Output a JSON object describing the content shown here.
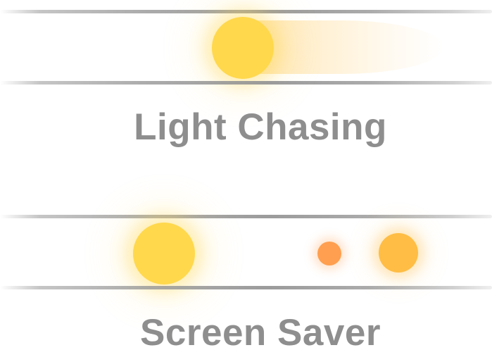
{
  "effects": [
    {
      "title": "Light Chasing",
      "colors": {
        "orb": "#FFD84C",
        "trail": "#FFCE60",
        "rail": "#969696"
      }
    },
    {
      "title": "Screen Saver",
      "colors": {
        "large_orb": "#FFD84C",
        "small_orb": "#FF9F4F",
        "medium_orb": "#FFBD45",
        "rail": "#969696"
      }
    }
  ],
  "colors": {
    "title_text": "#8E8E8E",
    "background": "#FFFFFF"
  }
}
